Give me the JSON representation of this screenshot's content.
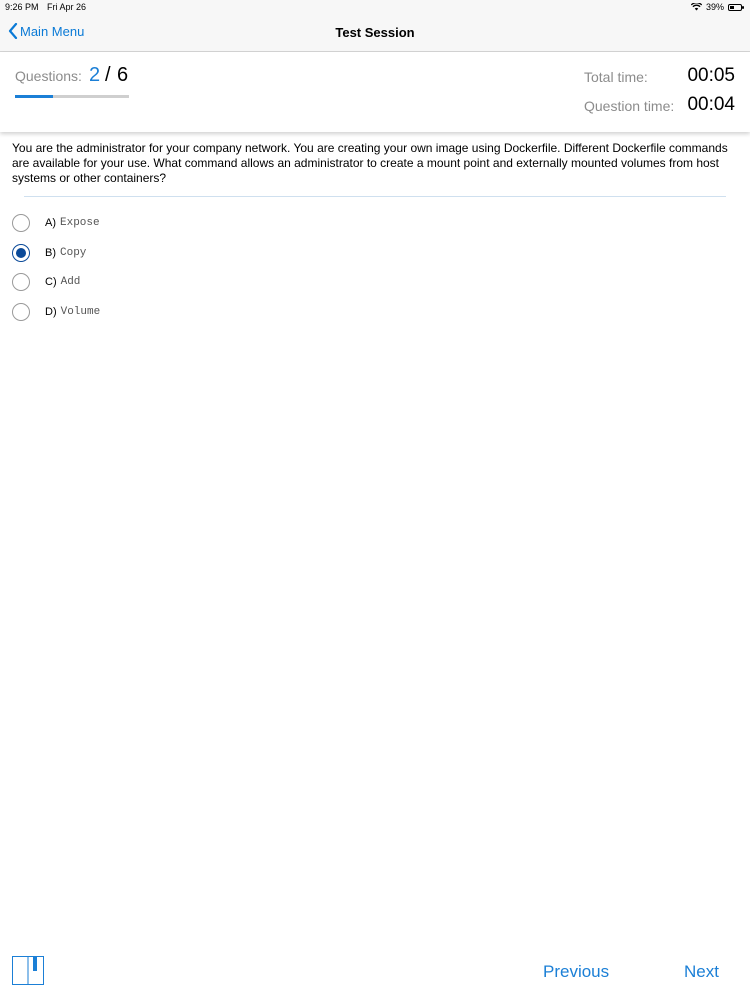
{
  "status_bar": {
    "time": "9:26 PM",
    "date": "Fri Apr 26",
    "battery": "39%",
    "battery_level": 0.39,
    "wifi_icon": "wifi-icon",
    "battery_icon": "battery-icon"
  },
  "nav": {
    "back_label": "Main Menu",
    "back_icon": "chevron-left-icon",
    "title": "Test Session"
  },
  "progress": {
    "label": "Questions:",
    "current": "2",
    "separator": "/",
    "total": "6",
    "fraction": 0.333
  },
  "timers": {
    "total_label": "Total time:",
    "total_value": "00:05",
    "question_label": "Question time:",
    "question_value": "00:04"
  },
  "question": {
    "text": "You are the administrator for your company network. You are creating your own image using Dockerfile. Different Dockerfile commands are available for your use. What command allows an administrator to create a mount point and externally mounted volumes from host systems or other containers?",
    "options": [
      {
        "letter": "A)",
        "text": "Expose",
        "selected": false
      },
      {
        "letter": "B)",
        "text": "Copy",
        "selected": true
      },
      {
        "letter": "C)",
        "text": "Add",
        "selected": false
      },
      {
        "letter": "D)",
        "text": "Volume",
        "selected": false
      }
    ]
  },
  "footer": {
    "bookmark_icon": "bookmark-icon",
    "previous_label": "Previous",
    "next_label": "Next"
  },
  "colors": {
    "accent": "#1b7fd6",
    "selected_radio": "#0b4a99",
    "muted_label": "#8c8c8c"
  }
}
